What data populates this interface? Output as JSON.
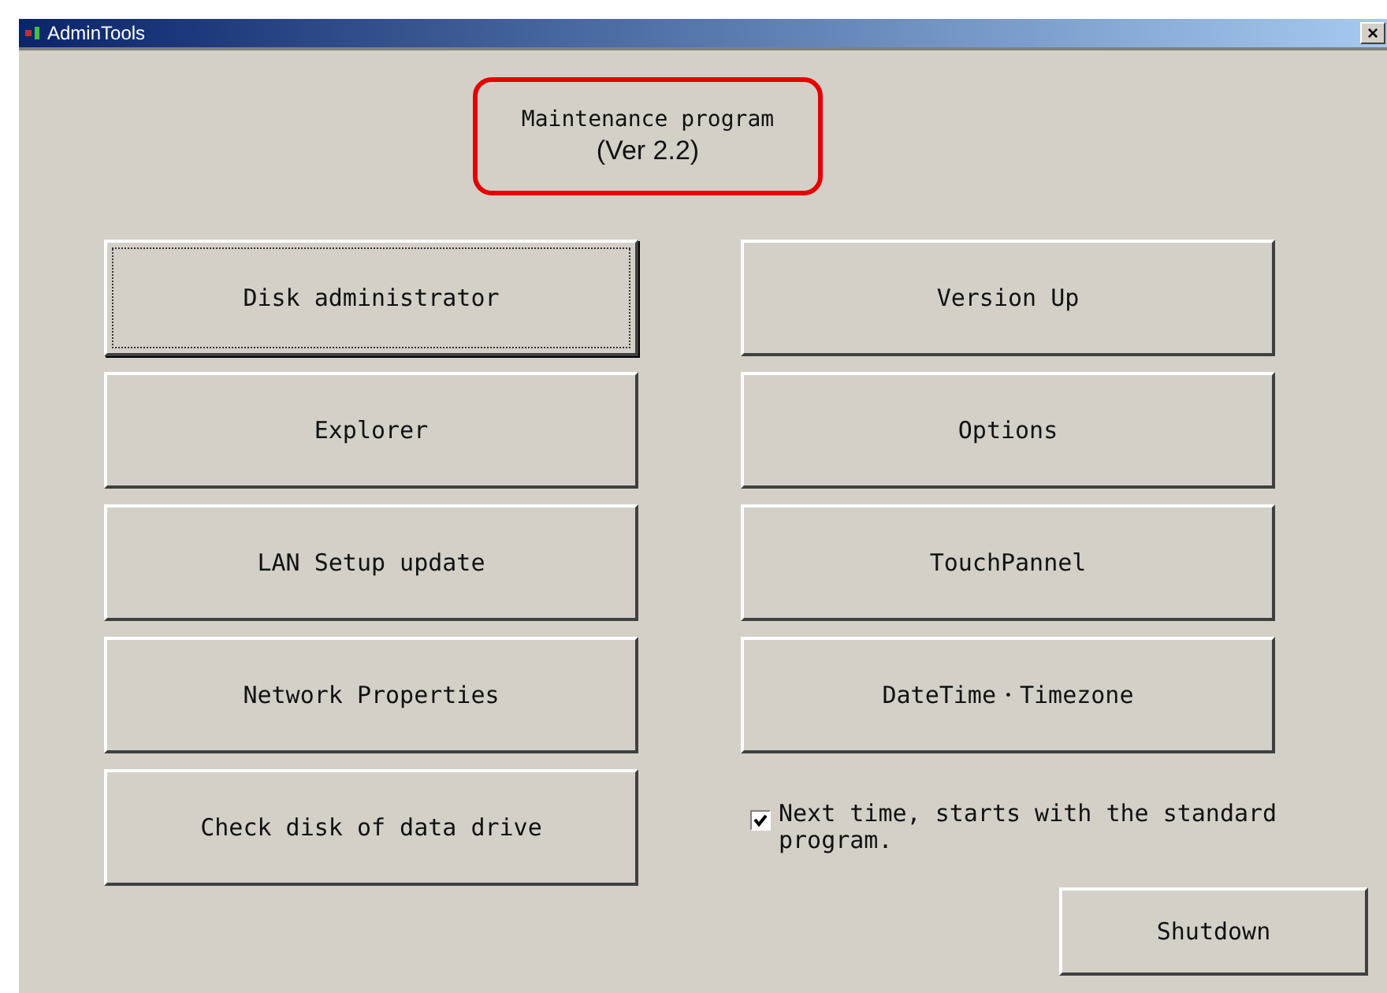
{
  "window": {
    "title": "AdminTools",
    "close": "×"
  },
  "header": {
    "title": "Maintenance program",
    "version": "(Ver 2.2)"
  },
  "left_buttons": [
    {
      "label": "Disk administrator",
      "focused": true
    },
    {
      "label": "Explorer",
      "focused": false
    },
    {
      "label": "LAN Setup update",
      "focused": false
    },
    {
      "label": "Network Properties",
      "focused": false
    },
    {
      "label": "Check disk of data drive",
      "focused": false
    }
  ],
  "right_buttons": [
    {
      "label": "Version Up",
      "focused": false
    },
    {
      "label": "Options",
      "focused": false
    },
    {
      "label": "TouchPannel",
      "focused": false
    },
    {
      "label": "DateTime・Timezone",
      "focused": false
    }
  ],
  "startup_option": {
    "label": "Next time, starts with the standard program.",
    "checked": true
  },
  "shutdown_button": {
    "label": "Shutdown"
  }
}
